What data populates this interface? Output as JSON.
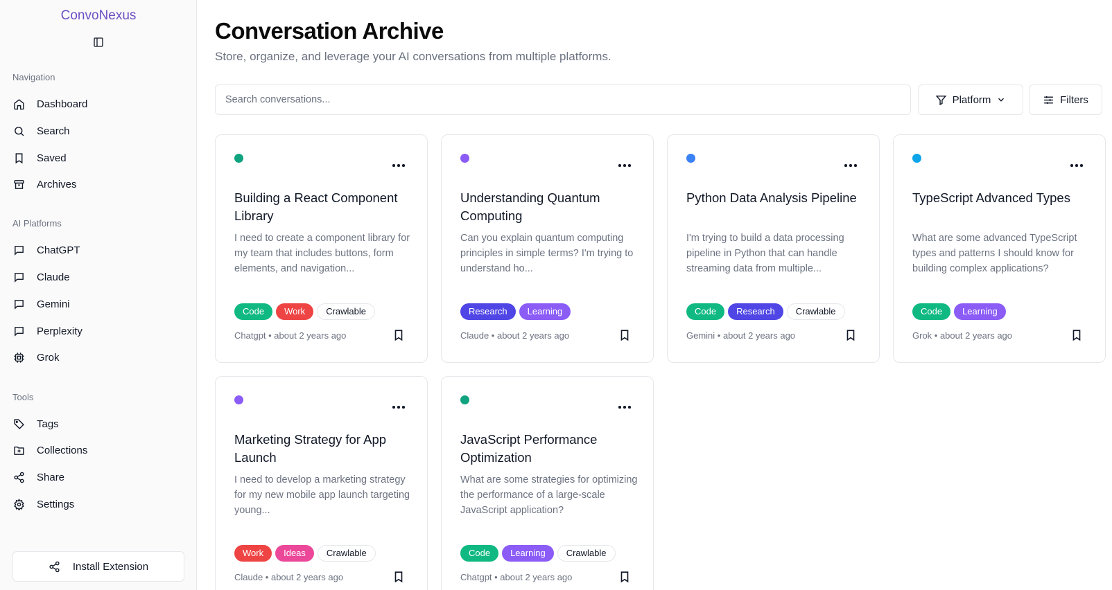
{
  "app": {
    "brand": "ConvoNexus"
  },
  "sidebar": {
    "navigation_label": "Navigation",
    "navigation": [
      {
        "label": "Dashboard",
        "icon": "home-icon"
      },
      {
        "label": "Search",
        "icon": "search-icon"
      },
      {
        "label": "Saved",
        "icon": "bookmark-icon"
      },
      {
        "label": "Archives",
        "icon": "archive-icon"
      }
    ],
    "platforms_label": "AI Platforms",
    "platforms": [
      {
        "label": "ChatGPT",
        "icon": "message-square-icon"
      },
      {
        "label": "Claude",
        "icon": "message-square-icon"
      },
      {
        "label": "Gemini",
        "icon": "message-square-icon"
      },
      {
        "label": "Perplexity",
        "icon": "message-square-icon"
      },
      {
        "label": "Grok",
        "icon": "cpu-icon"
      }
    ],
    "tools_label": "Tools",
    "tools": [
      {
        "label": "Tags",
        "icon": "tag-icon"
      },
      {
        "label": "Collections",
        "icon": "folder-plus-icon"
      },
      {
        "label": "Share",
        "icon": "share-icon"
      },
      {
        "label": "Settings",
        "icon": "gear-icon"
      }
    ],
    "install_label": "Install Extension"
  },
  "header": {
    "title": "Conversation Archive",
    "subtitle": "Store, organize, and leverage your AI conversations from multiple platforms."
  },
  "search": {
    "placeholder": "Search conversations..."
  },
  "filters": {
    "platform_label": "Platform",
    "filters_label": "Filters"
  },
  "colors": {
    "brand": "#6d4fc2",
    "tag_code": "#10b981",
    "tag_work": "#ef4444",
    "tag_research": "#4f46e5",
    "tag_learning": "#8b5cf6",
    "tag_ideas": "#ec4899",
    "dot_chatgpt": "#10a37f",
    "dot_claude": "#8b5cf6",
    "dot_gemini": "#3b82f6",
    "dot_grok": "#0ea5e9"
  },
  "conversations": [
    {
      "title": "Building a React Component Library",
      "description": "I need to create a component library for my team that includes buttons, form elements, and navigation...",
      "tags": [
        "Code",
        "Work",
        "Crawlable"
      ],
      "meta": "Chatgpt • about 2 years ago",
      "dot_color": "#10a37f"
    },
    {
      "title": "Understanding Quantum Computing",
      "description": "Can you explain quantum computing principles in simple terms? I'm trying to understand ho...",
      "tags": [
        "Research",
        "Learning"
      ],
      "meta": "Claude • about 2 years ago",
      "dot_color": "#8b5cf6"
    },
    {
      "title": "Python Data Analysis Pipeline",
      "description": "I'm trying to build a data processing pipeline in Python that can handle streaming data from multiple...",
      "tags": [
        "Code",
        "Research",
        "Crawlable"
      ],
      "meta": "Gemini • about 2 years ago",
      "dot_color": "#3b82f6"
    },
    {
      "title": "TypeScript Advanced Types",
      "description": "What are some advanced TypeScript types and patterns I should know for building complex applications?",
      "tags": [
        "Code",
        "Learning"
      ],
      "meta": "Grok • about 2 years ago",
      "dot_color": "#0ea5e9"
    },
    {
      "title": "Marketing Strategy for App Launch",
      "description": "I need to develop a marketing strategy for my new mobile app launch targeting young...",
      "tags": [
        "Work",
        "Ideas",
        "Crawlable"
      ],
      "meta": "Claude • about 2 years ago",
      "dot_color": "#8b5cf6"
    },
    {
      "title": "JavaScript Performance Optimization",
      "description": "What are some strategies for optimizing the performance of a large-scale JavaScript application?",
      "tags": [
        "Code",
        "Learning",
        "Crawlable"
      ],
      "meta": "Chatgpt • about 2 years ago",
      "dot_color": "#10a37f"
    }
  ]
}
